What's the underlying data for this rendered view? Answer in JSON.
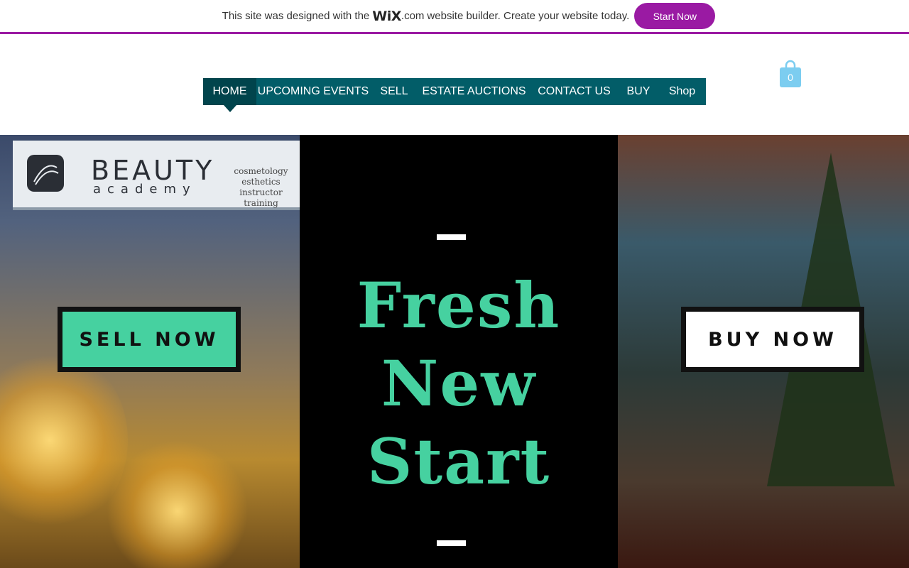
{
  "banner": {
    "text_before": "This site was designed with the",
    "logo": "WiX",
    "logo_suffix": ".com",
    "text_after": "website builder. Create your website today.",
    "cta_label": "Start Now",
    "accent_color": "#9a1aa3"
  },
  "nav": {
    "items": [
      {
        "label": "HOME",
        "active": true
      },
      {
        "label": "UPCOMING EVENTS",
        "active": false
      },
      {
        "label": "SELL",
        "active": false
      },
      {
        "label": "ESTATE AUCTIONS",
        "active": false
      },
      {
        "label": "CONTACT US",
        "active": false
      },
      {
        "label": "BUY",
        "active": false
      },
      {
        "label": "Shop",
        "active": false
      }
    ],
    "color": "#025d68"
  },
  "cart": {
    "icon": "shopping-bag-icon",
    "count": "0"
  },
  "hero": {
    "left_sign": {
      "title": "BEAUTY",
      "subtitle": "academy",
      "services": [
        "cosmetology",
        "esthetics",
        "instructor training"
      ]
    },
    "sell_label": "SELL NOW",
    "buy_label": "BUY NOW",
    "headline": [
      "Fresh",
      "New",
      "Start"
    ],
    "headline_color": "#46d1a0"
  }
}
